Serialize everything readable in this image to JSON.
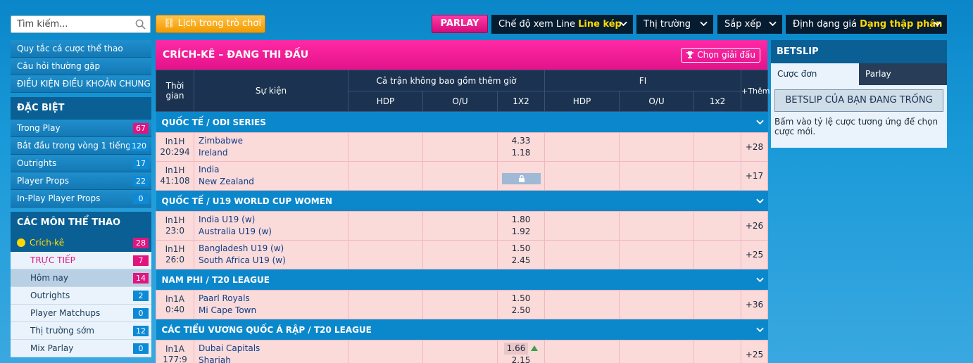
{
  "topbar": {
    "search_placeholder": "Tìm kiếm...",
    "schedule_label": "Lịch trong trò chơi",
    "parlay_label": "PARLAY",
    "view_mode_label": "Chế độ xem Line",
    "view_mode_value": "Line kép",
    "market_label": "Thị trường",
    "sort_label": "Sắp xếp",
    "odds_format_label": "Định dạng giá",
    "odds_format_value": "Dạng thập phân"
  },
  "sidebar": {
    "links": [
      "Quy tắc cá cược thể thao",
      "Câu hỏi thường gặp",
      "ĐIỀU KIỆN ĐIỀU KHOẢN CHUNG"
    ],
    "special_title": "ĐẶC BIỆT",
    "special_items": [
      {
        "label": "Trong Play",
        "count": "67"
      },
      {
        "label": "Bắt đầu trong vòng 1 tiếng",
        "count": "120"
      },
      {
        "label": "Outrights",
        "count": "17"
      },
      {
        "label": "Player Props",
        "count": "22"
      },
      {
        "label": "In-Play Player Props",
        "count": "0"
      }
    ],
    "sports_title": "CÁC MÔN THỂ THAO",
    "sport_active": {
      "label": "Crích-kê",
      "count": "28"
    },
    "sub_items": [
      {
        "label": "TRỰC TIẾP",
        "count": "7"
      },
      {
        "label": "Hôm nay",
        "count": "14"
      },
      {
        "label": "Outrights",
        "count": "2"
      },
      {
        "label": "Player Matchups",
        "count": "0"
      },
      {
        "label": "Thị trường sớm",
        "count": "12"
      },
      {
        "label": "Mix Parlay",
        "count": "0"
      }
    ]
  },
  "main": {
    "title": "CRÍCH-KÊ – ĐANG THI ĐẤU",
    "choose_label": "Chọn giải đấu",
    "headers": {
      "time": "Thời gian",
      "event": "Sự kiện",
      "full": "Cả trận không bao gồm thêm giờ",
      "fi": "FI",
      "more": "+Thêm",
      "hdp": "HDP",
      "ou": "O/U",
      "x12": "1X2",
      "x12b": "1x2"
    },
    "leagues": [
      {
        "name": "QUỐC TẾ / ODI SERIES",
        "matches": [
          {
            "time1": "In1H",
            "time2": "20:294",
            "home": "Zimbabwe",
            "away": "Ireland",
            "o1": "4.33",
            "o2": "1.18",
            "more": "+28"
          },
          {
            "time1": "In1H",
            "time2": "41:108",
            "home": "India",
            "away": "New Zealand",
            "o1": "",
            "o2": "",
            "more": "+17",
            "locked": true
          }
        ]
      },
      {
        "name": "QUỐC TẾ / U19 WORLD CUP WOMEN",
        "matches": [
          {
            "time1": "In1H",
            "time2": "23:0",
            "home": "India U19 (w)",
            "away": "Australia U19 (w)",
            "o1": "1.80",
            "o2": "1.92",
            "more": "+26"
          },
          {
            "time1": "In1H",
            "time2": "26:0",
            "home": "Bangladesh U19 (w)",
            "away": "South Africa U19 (w)",
            "o1": "1.50",
            "o2": "2.45",
            "more": "+25"
          }
        ]
      },
      {
        "name": "NAM PHI / T20 LEAGUE",
        "matches": [
          {
            "time1": "In1A",
            "time2": "0:40",
            "home": "Paarl Royals",
            "away": "Mi Cape Town",
            "o1": "1.50",
            "o2": "2.50",
            "more": "+36"
          }
        ]
      },
      {
        "name": "CÁC TIỂU VƯƠNG QUỐC Á RẬP / T20 LEAGUE",
        "matches": [
          {
            "time1": "In1A",
            "time2": "177:9",
            "home": "Dubai Capitals",
            "away": "Sharjah",
            "o1": "1.66",
            "o2": "2.15",
            "more": "+25",
            "up": true
          }
        ]
      }
    ]
  },
  "betslip": {
    "title": "BETSLIP",
    "tab_single": "Cược đơn",
    "tab_parlay": "Parlay",
    "empty": "BETSLIP CỦA BẠN ĐANG TRỐNG",
    "hint": "Bấm vào tỷ lệ cược tương ứng để chọn cược mới."
  },
  "colors": {
    "brand_pink": "#e3128a",
    "brand_blue": "#0b88cc",
    "navy": "#1b3350"
  }
}
